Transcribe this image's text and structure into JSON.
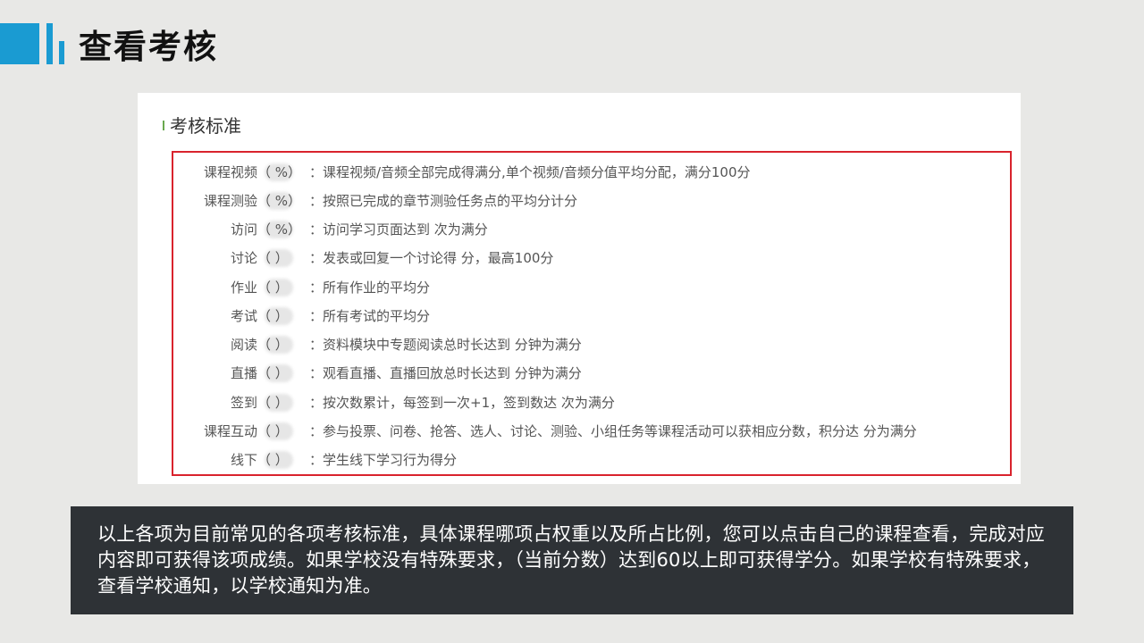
{
  "slide": {
    "title": "查看考核"
  },
  "panel": {
    "section_title": "考核标准",
    "rows": [
      {
        "label": "课程视频",
        "pct": "（   %）",
        "desc": "：课程视频/音频全部完成得满分,单个视频/音频分值平均分配，满分100分"
      },
      {
        "label": "课程测验",
        "pct": "（   %）",
        "desc": "：按照已完成的章节测验任务点的平均分计分"
      },
      {
        "label": "访问",
        "pct": "（   %）",
        "desc": "：访问学习页面达到     次为满分"
      },
      {
        "label": "讨论",
        "pct": "（    ）",
        "desc": "：发表或回复一个讨论得     分，最高100分"
      },
      {
        "label": "作业",
        "pct": "（    ）",
        "desc": "：所有作业的平均分"
      },
      {
        "label": "考试",
        "pct": "（    ）",
        "desc": "：所有考试的平均分"
      },
      {
        "label": "阅读",
        "pct": "（    ）",
        "desc": "：资料模块中专题阅读总时长达到     分钟为满分"
      },
      {
        "label": "直播",
        "pct": "（    ）",
        "desc": "：观看直播、直播回放总时长达到     分钟为满分"
      },
      {
        "label": "签到",
        "pct": "（    ）",
        "desc": "：按次数累计，每签到一次+1，签到数达     次为满分"
      },
      {
        "label": "课程互动",
        "pct": "（    ）",
        "desc": "：参与投票、问卷、抢答、选人、讨论、测验、小组任务等课程活动可以获相应分数，积分达     分为满分"
      },
      {
        "label": "线下",
        "pct": "（    ）",
        "desc": "：学生线下学习行为得分"
      }
    ]
  },
  "note": {
    "text": "以上各项为目前常见的各项考核标准，具体课程哪项占权重以及所占比例，您可以点击自己的课程查看，完成对应内容即可获得该项成绩。如果学校没有特殊要求，（当前分数）达到60以上即可获得学分。如果学校有特殊要求，查看学校通知，以学校通知为准。"
  },
  "colors": {
    "accent": "#1a9bd2",
    "highlight_border": "#d9232d",
    "note_background": "#2e3236"
  }
}
